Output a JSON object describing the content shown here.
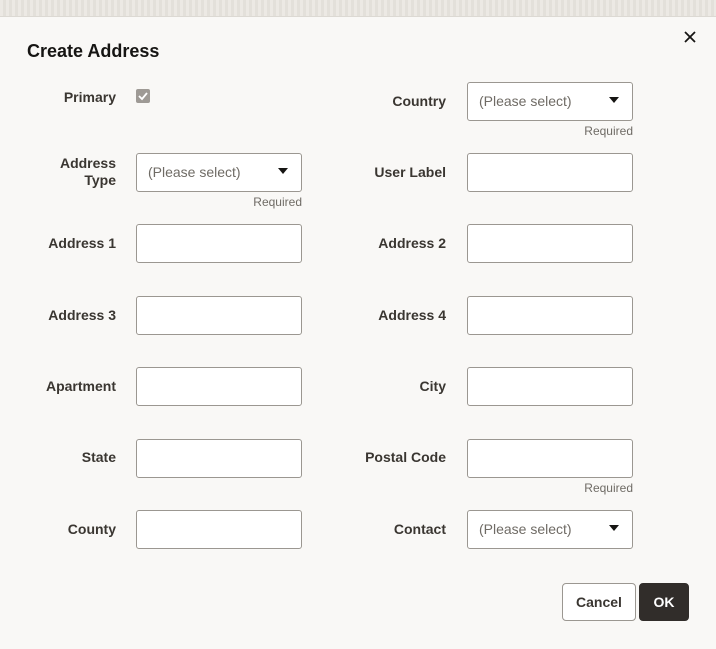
{
  "dialog": {
    "title": "Create Address",
    "close_icon": "close-icon"
  },
  "form": {
    "primary": {
      "label": "Primary",
      "checked": true
    },
    "country": {
      "label": "Country",
      "placeholder": "(Please select)",
      "required": "Required"
    },
    "address_type": {
      "label_line1": "Address",
      "label_line2": "Type",
      "placeholder": "(Please select)",
      "required": "Required"
    },
    "user_label": {
      "label": "User Label",
      "value": ""
    },
    "address1": {
      "label": "Address 1",
      "value": ""
    },
    "address2": {
      "label": "Address 2",
      "value": ""
    },
    "address3": {
      "label": "Address 3",
      "value": ""
    },
    "address4": {
      "label": "Address 4",
      "value": ""
    },
    "apartment": {
      "label": "Apartment",
      "value": ""
    },
    "city": {
      "label": "City",
      "value": ""
    },
    "state": {
      "label": "State",
      "value": ""
    },
    "postal_code": {
      "label": "Postal Code",
      "value": "",
      "required": "Required"
    },
    "county": {
      "label": "County",
      "value": ""
    },
    "contact": {
      "label": "Contact",
      "placeholder": "(Please select)"
    }
  },
  "buttons": {
    "cancel": "Cancel",
    "ok": "OK"
  }
}
